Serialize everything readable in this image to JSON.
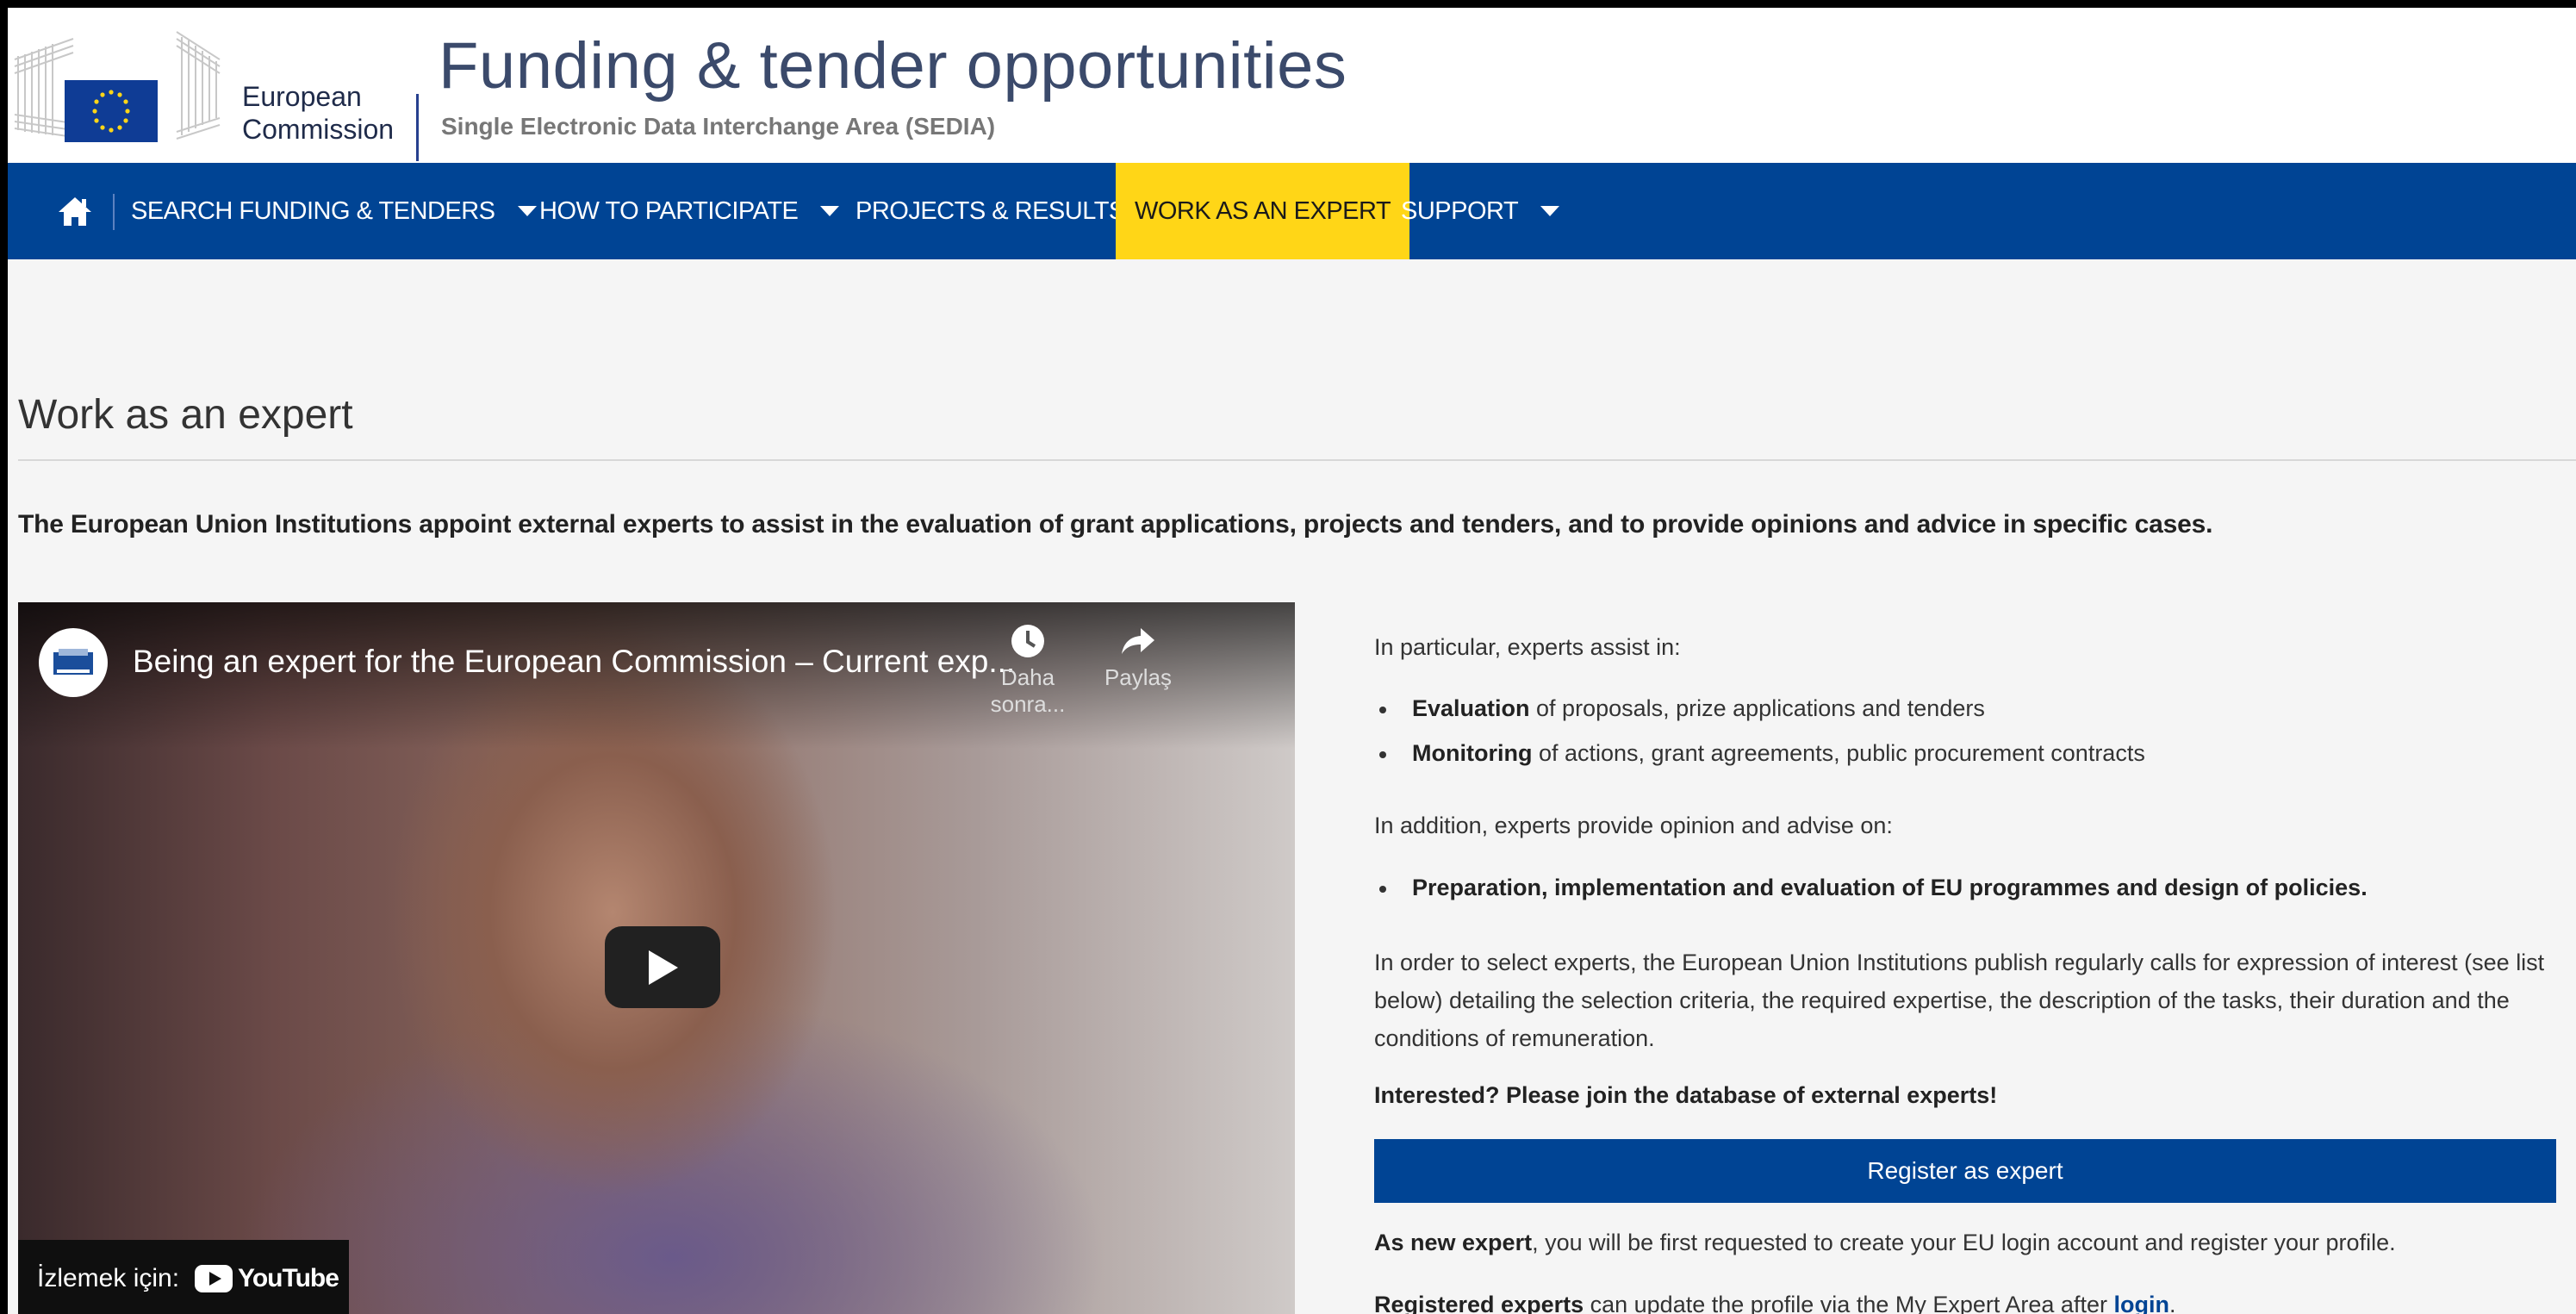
{
  "header": {
    "logo_text_line1": "European",
    "logo_text_line2": "Commission",
    "site_title": "Funding & tender opportunities",
    "site_subtitle": "Single Electronic Data Interchange Area (SEDIA)"
  },
  "nav": {
    "items": [
      {
        "label": "SEARCH FUNDING & TENDERS",
        "has_caret": true
      },
      {
        "label": "HOW TO PARTICIPATE",
        "has_caret": true
      },
      {
        "label": "PROJECTS & RESULTS",
        "has_caret": false
      },
      {
        "label": "WORK AS AN EXPERT",
        "active": true
      },
      {
        "label": "SUPPORT",
        "has_caret": true
      }
    ],
    "colors": {
      "bar": "#004494",
      "active": "#ffd617"
    }
  },
  "main": {
    "title": "Work as an expert",
    "intro": "The European Union Institutions appoint external experts to assist in the evaluation of grant applications, projects and tenders, and to provide opinions and advice in specific cases."
  },
  "video": {
    "title": "Being an expert for the European Commission – Current exp...",
    "watch_later": "Daha sonra...",
    "share": "Paylaş",
    "watch_on": "İzlemek için:",
    "youtube": "YouTube"
  },
  "content": {
    "p1": "In particular, experts assist in:",
    "bullet1_bold": "Evaluation",
    "bullet1_rest": " of proposals, prize applications and tenders",
    "bullet2_bold": "Monitoring",
    "bullet2_rest": " of actions, grant agreements, public procurement contracts",
    "p2": "In addition, experts provide opinion and advise on:",
    "bullet3": "Preparation, implementation and evaluation of EU programmes and design of policies.",
    "p3": "In order to select experts, the European Union Institutions publish regularly calls for expression of interest (see list below) detailing the selection criteria, the required expertise, the description of the tasks, their duration and the conditions of remuneration.",
    "p4": "Interested? Please join the database of external experts!",
    "register_button": "Register as expert",
    "p5_bold": "As new expert",
    "p5_rest": ", you will be first requested to create your EU login account and register your profile.",
    "p6_bold": "Registered experts",
    "p6_rest": " can update the profile via the My Expert Area after ",
    "p6_link": "login",
    "p6_end": "."
  }
}
